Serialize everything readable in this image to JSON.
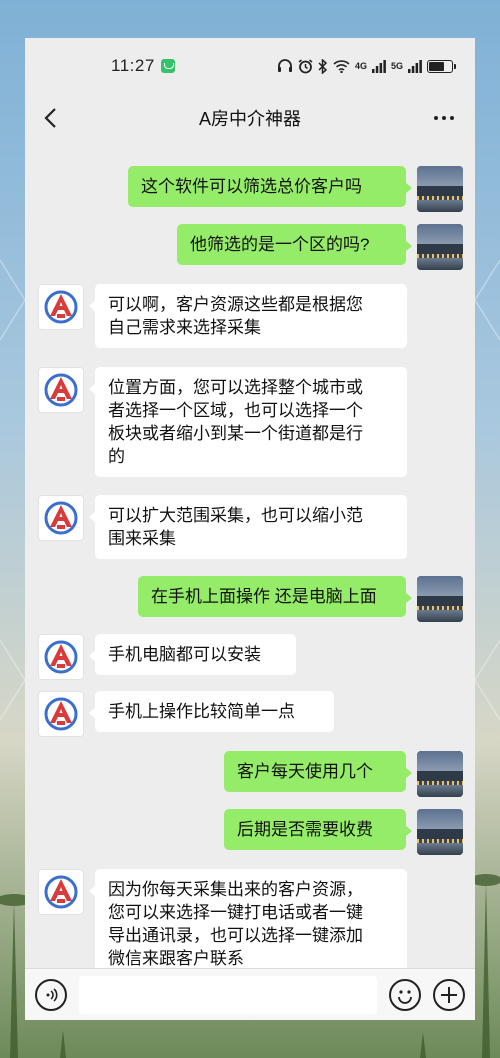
{
  "status_bar": {
    "time": "11:27",
    "network_1": "4G",
    "network_2": "5G",
    "battery_level": 0.7,
    "icons": [
      "headphone-icon",
      "alarm-icon",
      "bluetooth-icon",
      "wifi-icon",
      "signal-icon",
      "signal-icon",
      "battery-icon"
    ]
  },
  "header": {
    "title": "A房中介神器",
    "back_icon": "chevron-left-icon",
    "more_icon": "more-icon"
  },
  "messages": [
    {
      "side": "out",
      "lines": [
        "这个软件可以筛选总价客户吗"
      ]
    },
    {
      "side": "out",
      "lines": [
        "他筛选的是一个区的吗?"
      ]
    },
    {
      "side": "in",
      "lines": [
        "可以啊，客户资源这些都是根据您",
        "自己需求来选择采集"
      ]
    },
    {
      "side": "in",
      "lines": [
        "位置方面，您可以选择整个城市或",
        "者选择一个区域，也可以选择一个",
        "板块或者缩小到某一个街道都是行",
        "的"
      ]
    },
    {
      "side": "in",
      "lines": [
        "可以扩大范围采集，也可以缩小范",
        "围来采集"
      ]
    },
    {
      "side": "out",
      "lines": [
        "在手机上面操作 还是电脑上面"
      ]
    },
    {
      "side": "in",
      "lines": [
        "手机电脑都可以安装"
      ]
    },
    {
      "side": "in",
      "lines": [
        "手机上操作比较简单一点"
      ]
    },
    {
      "side": "out",
      "lines": [
        "客户每天使用几个"
      ]
    },
    {
      "side": "out",
      "lines": [
        "后期是否需要收费"
      ]
    },
    {
      "side": "in",
      "lines": [
        "因为你每天采集出来的客户资源，",
        "您可以来选择一键打电话或者一键",
        "导出通讯录，也可以选择一键添加",
        "微信来跟客户联系"
      ]
    }
  ],
  "input_bar": {
    "value": "",
    "voice_icon": "voice-icon",
    "emoji_icon": "emoji-icon",
    "plus_icon": "plus-icon"
  },
  "colors": {
    "outgoing_bubble": "#95ec69",
    "incoming_bubble": "#ffffff",
    "chat_background": "#ededed",
    "app_logo_red": "#d93a3a",
    "app_logo_blue": "#3a6fd0"
  }
}
